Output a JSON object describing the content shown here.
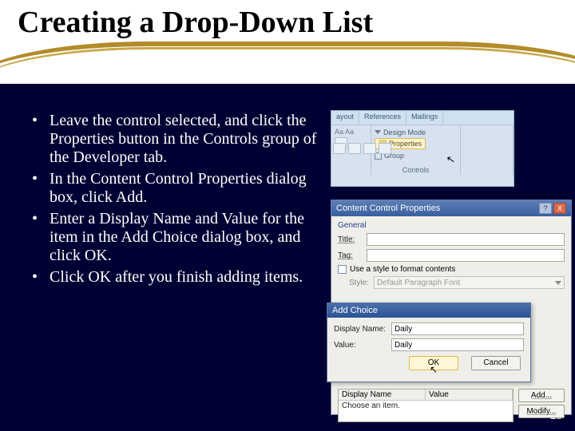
{
  "title": "Creating a Drop-Down List",
  "bullets": [
    "Leave the control selected, and click the Properties button in the Controls group of the Developer tab.",
    "In the Content Control Properties dialog box, click Add.",
    "Enter a Display Name and Value for the item in the Add Choice dialog box, and click OK.",
    "Click OK after you finish adding items."
  ],
  "page_number": "25",
  "ribbon": {
    "tabs": [
      "ayout",
      "References",
      "Mailings"
    ],
    "font_sample": "Aa",
    "design_mode": "Design Mode",
    "properties": "Properties",
    "group_btn": "Group",
    "controls_label": "Controls"
  },
  "dialog": {
    "title": "Content Control Properties",
    "help": "?",
    "close": "X",
    "general": "General",
    "title_label": "Title:",
    "tag_label": "Tag:",
    "use_style": "Use a style to format contents",
    "style_label": "Style:",
    "style_value": "Default Paragraph Font",
    "list_hdr1": "Display Name",
    "list_hdr2": "Value",
    "list_row": "Choose an item.",
    "add_btn": "Add...",
    "modify_btn": "Modify..."
  },
  "sub_dialog": {
    "title": "Add Choice",
    "disp_label": "Display Name:",
    "disp_value": "Daily",
    "val_label": "Value:",
    "val_value": "Daily",
    "ok": "OK",
    "cancel": "Cancel"
  }
}
